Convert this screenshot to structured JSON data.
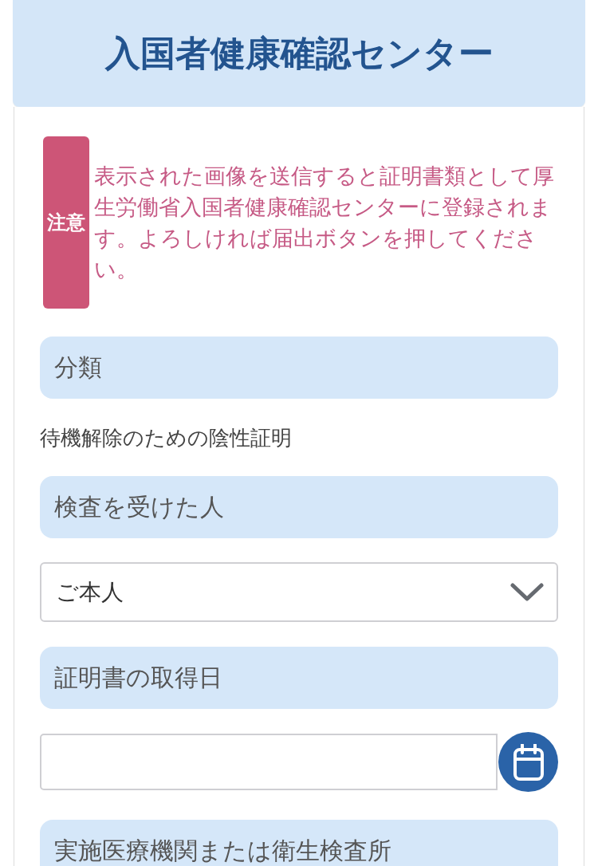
{
  "header": {
    "title": "入国者健康確認センター"
  },
  "notice": {
    "badge": "注意",
    "text": "表示された画像を送信すると証明書類として厚生労働省入国者健康確認センターに登録されます。よろしければ届出ボタンを押してください。"
  },
  "form": {
    "fields": [
      {
        "kind": "text",
        "label": "分類",
        "value": "待機解除のための陰性証明"
      },
      {
        "kind": "select",
        "label": "検査を受けた人",
        "value": "ご本人"
      },
      {
        "kind": "date",
        "label": "証明書の取得日"
      },
      {
        "kind": "text",
        "label": "実施医療機関または衛生検査所"
      }
    ]
  }
}
